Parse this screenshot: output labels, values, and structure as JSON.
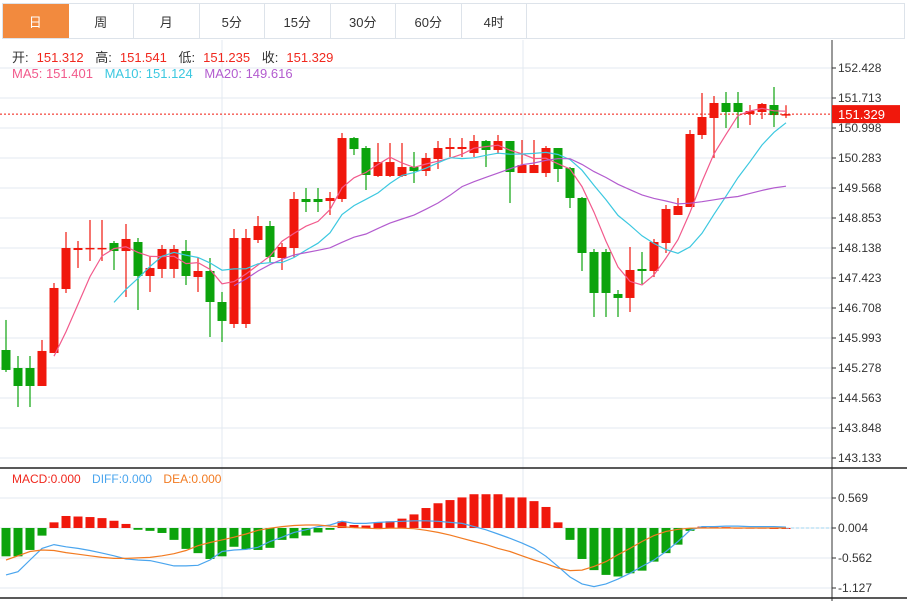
{
  "tabs": [
    "日",
    "周",
    "月",
    "5分",
    "15分",
    "30分",
    "60分",
    "4时"
  ],
  "active_tab": 0,
  "ohlc_info": {
    "open_label": "开:",
    "open": "151.312",
    "high_label": "高:",
    "high": "151.541",
    "low_label": "低:",
    "low": "151.235",
    "close_label": "收:",
    "close": "151.329"
  },
  "ma_info": {
    "ma5": "MA5: 151.401",
    "ma10": "MA10: 151.124",
    "ma20": "MA20: 149.616"
  },
  "macd_info": {
    "macd": "MACD:0.000",
    "diff": "DIFF:0.000",
    "dea": "DEA:0.000"
  },
  "colors": {
    "up": "#f0180c",
    "down": "#0ca30c",
    "ma5": "#f25a8c",
    "ma10": "#3cc8e0",
    "ma20": "#b35ccf",
    "diff": "#4aa5ee",
    "dea": "#f27b22",
    "tab_active": "#f28a3e"
  },
  "chart_data": {
    "type": "candlestick",
    "price_axis": {
      "range": [
        143.133,
        152.428
      ],
      "ticks": [
        "152.428",
        "151.713",
        "150.998",
        "150.283",
        "149.568",
        "148.853",
        "148.138",
        "147.423",
        "146.708",
        "145.993",
        "145.278",
        "144.563",
        "143.848",
        "143.133"
      ]
    },
    "last_price": {
      "value": 151.329,
      "label": "151.329"
    },
    "candles": [
      [
        145.707,
        146.423,
        145.183,
        145.231
      ],
      [
        145.278,
        145.564,
        144.348,
        144.849
      ],
      [
        145.278,
        145.564,
        144.348,
        144.849
      ],
      [
        144.849,
        145.946,
        144.849,
        145.684
      ],
      [
        145.636,
        147.304,
        145.636,
        147.185
      ],
      [
        147.161,
        148.519,
        147.066,
        148.138
      ],
      [
        148.09,
        148.305,
        147.662,
        148.138
      ],
      [
        148.13,
        148.806,
        147.828,
        148.14
      ],
      [
        148.13,
        148.806,
        147.828,
        148.14
      ],
      [
        148.257,
        148.305,
        147.614,
        148.066
      ],
      [
        148.066,
        148.71,
        146.97,
        148.353
      ],
      [
        148.281,
        148.376,
        146.661,
        147.471
      ],
      [
        147.471,
        147.947,
        147.09,
        147.662
      ],
      [
        147.638,
        148.21,
        147.423,
        148.114
      ],
      [
        147.638,
        148.21,
        147.423,
        148.114
      ],
      [
        148.066,
        148.329,
        147.256,
        147.471
      ],
      [
        147.447,
        147.9,
        147.09,
        147.59
      ],
      [
        147.59,
        147.9,
        146.017,
        146.851
      ],
      [
        146.851,
        147.09,
        145.898,
        146.399
      ],
      [
        146.327,
        148.591,
        146.232,
        148.376
      ],
      [
        146.327,
        148.591,
        146.232,
        148.376
      ],
      [
        148.329,
        148.901,
        148.257,
        148.662
      ],
      [
        148.662,
        148.782,
        147.805,
        147.924
      ],
      [
        147.9,
        148.257,
        147.614,
        148.162
      ],
      [
        148.138,
        149.473,
        147.924,
        149.306
      ],
      [
        149.306,
        149.568,
        148.996,
        149.234
      ],
      [
        149.306,
        149.568,
        148.996,
        149.234
      ],
      [
        149.258,
        149.473,
        148.925,
        149.33
      ],
      [
        149.306,
        150.879,
        149.234,
        150.759
      ],
      [
        150.759,
        150.783,
        150.354,
        150.497
      ],
      [
        150.521,
        150.569,
        149.52,
        149.878
      ],
      [
        149.854,
        150.64,
        149.83,
        150.187
      ],
      [
        149.854,
        150.64,
        149.83,
        150.187
      ],
      [
        149.854,
        150.64,
        149.83,
        150.068
      ],
      [
        150.068,
        150.426,
        149.687,
        149.973
      ],
      [
        149.973,
        150.402,
        149.854,
        150.283
      ],
      [
        150.259,
        150.688,
        150.021,
        150.521
      ],
      [
        150.497,
        150.759,
        150.307,
        150.545
      ],
      [
        150.497,
        150.759,
        150.307,
        150.545
      ],
      [
        150.402,
        150.831,
        150.307,
        150.688
      ],
      [
        150.688,
        150.712,
        150.068,
        150.474
      ],
      [
        150.474,
        150.831,
        150.378,
        150.688
      ],
      [
        150.688,
        150.688,
        149.21,
        149.949
      ],
      [
        149.925,
        150.712,
        149.925,
        150.116
      ],
      [
        149.925,
        150.712,
        149.925,
        150.116
      ],
      [
        149.925,
        150.569,
        149.83,
        150.521
      ],
      [
        150.521,
        150.521,
        149.711,
        150.021
      ],
      [
        150.044,
        150.068,
        149.091,
        149.33
      ],
      [
        149.33,
        149.353,
        147.59,
        148.019
      ],
      [
        148.043,
        148.114,
        146.494,
        147.066
      ],
      [
        148.043,
        148.114,
        146.494,
        147.066
      ],
      [
        147.042,
        147.137,
        146.494,
        146.947
      ],
      [
        146.947,
        148.162,
        146.613,
        147.614
      ],
      [
        147.638,
        148.043,
        147.28,
        147.59
      ],
      [
        147.59,
        148.353,
        147.447,
        148.281
      ],
      [
        148.257,
        149.163,
        148.019,
        149.068
      ],
      [
        148.925,
        149.33,
        148.925,
        149.139
      ],
      [
        149.115,
        150.95,
        149.115,
        150.855
      ],
      [
        150.831,
        151.832,
        150.736,
        151.26
      ],
      [
        151.236,
        151.76,
        150.283,
        151.594
      ],
      [
        151.594,
        151.856,
        150.998,
        151.379
      ],
      [
        151.594,
        151.856,
        150.998,
        151.379
      ],
      [
        151.331,
        151.546,
        151.069,
        151.403
      ],
      [
        151.379,
        151.594,
        151.212,
        151.57
      ],
      [
        151.546,
        151.975,
        151.022,
        151.307
      ],
      [
        151.312,
        151.541,
        151.235,
        151.329
      ]
    ],
    "candle_format": [
      "open",
      "high",
      "low",
      "close"
    ],
    "ma_periods": [
      5,
      10,
      20
    ],
    "macd_axis": {
      "range": [
        -1.127,
        0.569
      ],
      "ticks": [
        "0.569",
        "0.004",
        "-0.562",
        "-1.127"
      ]
    },
    "macd_hist": [
      -0.53,
      -0.53,
      -0.41,
      -0.14,
      0.11,
      0.23,
      0.22,
      0.21,
      0.19,
      0.14,
      0.08,
      -0.03,
      -0.05,
      -0.09,
      -0.22,
      -0.39,
      -0.47,
      -0.58,
      -0.53,
      -0.35,
      -0.4,
      -0.41,
      -0.37,
      -0.22,
      -0.19,
      -0.14,
      -0.08,
      -0.03,
      0.13,
      0.06,
      0.05,
      0.11,
      0.13,
      0.18,
      0.26,
      0.38,
      0.47,
      0.53,
      0.58,
      0.64,
      0.64,
      0.64,
      0.58,
      0.58,
      0.51,
      0.4,
      0.11,
      -0.22,
      -0.58,
      -0.79,
      -0.88,
      -0.91,
      -0.85,
      -0.8,
      -0.63,
      -0.47,
      -0.31,
      -0.05,
      0.03,
      0.02,
      0.02,
      0.01,
      0.01,
      0.01,
      0.0,
      0.0
    ],
    "diff": [
      -0.88,
      -0.82,
      -0.6,
      -0.38,
      -0.31,
      -0.35,
      -0.38,
      -0.42,
      -0.47,
      -0.52,
      -0.58,
      -0.6,
      -0.61,
      -0.66,
      -0.71,
      -0.71,
      -0.7,
      -0.6,
      -0.44,
      -0.41,
      -0.4,
      -0.36,
      -0.25,
      -0.17,
      -0.08,
      -0.03,
      0.03,
      0.06,
      0.13,
      0.09,
      0.09,
      0.11,
      0.12,
      0.13,
      0.14,
      0.14,
      0.13,
      0.11,
      0.09,
      0.03,
      -0.03,
      -0.11,
      -0.19,
      -0.28,
      -0.38,
      -0.53,
      -0.72,
      -0.92,
      -1.05,
      -1.1,
      -1.05,
      -0.96,
      -0.85,
      -0.72,
      -0.6,
      -0.44,
      -0.25,
      -0.04,
      0.03,
      0.03,
      0.04,
      0.04,
      0.03,
      0.03,
      0.03,
      0.02
    ],
    "dea": [
      -0.6,
      -0.52,
      -0.44,
      -0.41,
      -0.42,
      -0.46,
      -0.49,
      -0.52,
      -0.55,
      -0.57,
      -0.57,
      -0.56,
      -0.55,
      -0.52,
      -0.48,
      -0.42,
      -0.33,
      -0.27,
      -0.22,
      -0.17,
      -0.11,
      -0.04,
      0.0,
      0.03,
      0.05,
      0.06,
      0.06,
      0.04,
      0.03,
      0.01,
      0.0,
      -0.01,
      0.0,
      0.0,
      -0.01,
      -0.04,
      -0.08,
      -0.13,
      -0.19,
      -0.25,
      -0.31,
      -0.38,
      -0.44,
      -0.52,
      -0.6,
      -0.67,
      -0.75,
      -0.8,
      -0.79,
      -0.72,
      -0.63,
      -0.5,
      -0.38,
      -0.25,
      -0.14,
      -0.06,
      -0.02,
      0.0,
      0.004,
      0.004,
      0.004,
      0.004,
      0.004,
      0.004,
      0.004,
      0.004
    ]
  }
}
